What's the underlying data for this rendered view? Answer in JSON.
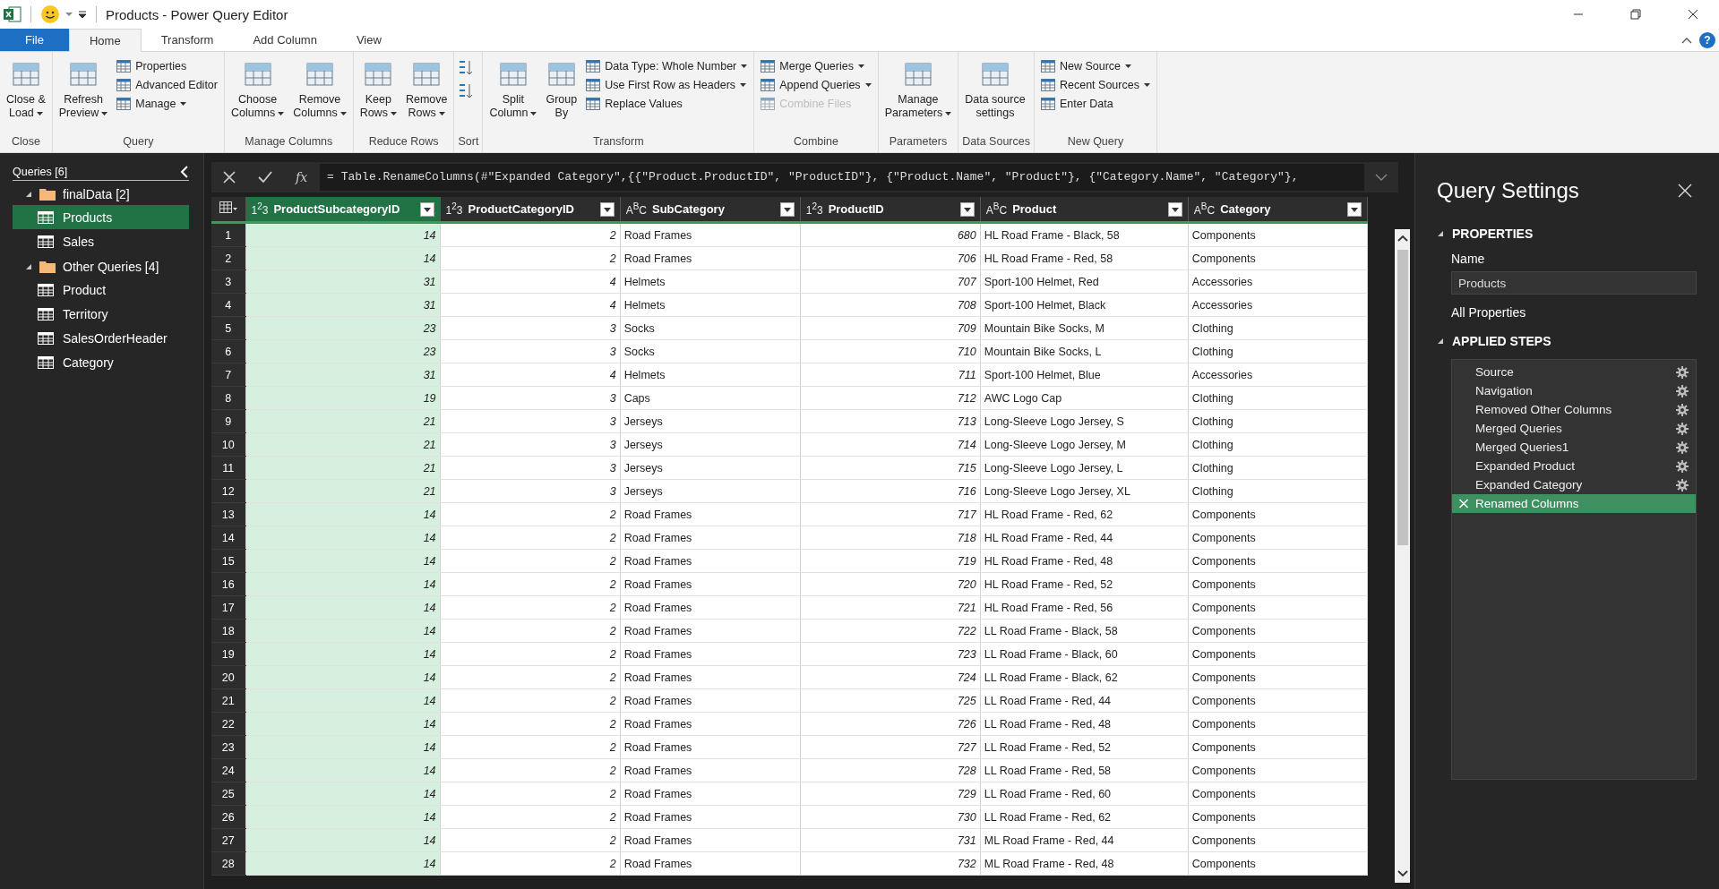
{
  "window": {
    "title": "Products - Power Query Editor",
    "help": "?"
  },
  "tabs": [
    {
      "label": "File",
      "kind": "file",
      "selected": false
    },
    {
      "label": "Home",
      "kind": "tab",
      "selected": true
    },
    {
      "label": "Transform",
      "kind": "tab",
      "selected": false
    },
    {
      "label": "Add Column",
      "kind": "tab",
      "selected": false
    },
    {
      "label": "View",
      "kind": "tab",
      "selected": false
    }
  ],
  "ribbon": {
    "groups": [
      {
        "label": "Close",
        "items": [
          {
            "kind": "large",
            "lines": [
              "Close &",
              "Load"
            ],
            "dropdown": true,
            "disabled": false
          }
        ]
      },
      {
        "label": "Query",
        "items": [
          {
            "kind": "large",
            "lines": [
              "Refresh",
              "Preview"
            ],
            "dropdown": true,
            "disabled": false
          },
          {
            "kind": "small",
            "lines": [
              "Properties"
            ],
            "dropdown": false,
            "disabled": false
          },
          {
            "kind": "small",
            "lines": [
              "Advanced Editor"
            ],
            "dropdown": false,
            "disabled": false
          },
          {
            "kind": "small",
            "lines": [
              "Manage"
            ],
            "dropdown": true,
            "disabled": false
          }
        ]
      },
      {
        "label": "Manage Columns",
        "items": [
          {
            "kind": "large",
            "lines": [
              "Choose",
              "Columns"
            ],
            "dropdown": true,
            "disabled": false
          },
          {
            "kind": "large",
            "lines": [
              "Remove",
              "Columns"
            ],
            "dropdown": true,
            "disabled": false
          }
        ]
      },
      {
        "label": "Reduce Rows",
        "items": [
          {
            "kind": "large",
            "lines": [
              "Keep",
              "Rows"
            ],
            "dropdown": true,
            "disabled": false
          },
          {
            "kind": "large",
            "lines": [
              "Remove",
              "Rows"
            ],
            "dropdown": true,
            "disabled": false
          }
        ]
      },
      {
        "label": "Sort",
        "items": [
          {
            "kind": "sort"
          }
        ]
      },
      {
        "label": "Transform",
        "items": [
          {
            "kind": "large",
            "lines": [
              "Split",
              "Column"
            ],
            "dropdown": true,
            "disabled": false
          },
          {
            "kind": "large",
            "lines": [
              "Group",
              "By"
            ],
            "dropdown": false,
            "disabled": false
          },
          {
            "kind": "small",
            "lines": [
              "Data Type: Whole Number"
            ],
            "dropdown": true,
            "disabled": false
          },
          {
            "kind": "small",
            "lines": [
              "Use First Row as Headers"
            ],
            "dropdown": true,
            "disabled": false
          },
          {
            "kind": "small",
            "lines": [
              "Replace Values"
            ],
            "dropdown": false,
            "disabled": false
          }
        ]
      },
      {
        "label": "Combine",
        "items": [
          {
            "kind": "small",
            "lines": [
              "Merge Queries"
            ],
            "dropdown": true,
            "disabled": false
          },
          {
            "kind": "small",
            "lines": [
              "Append Queries"
            ],
            "dropdown": true,
            "disabled": false
          },
          {
            "kind": "small",
            "lines": [
              "Combine Files"
            ],
            "dropdown": false,
            "disabled": true
          }
        ]
      },
      {
        "label": "Parameters",
        "items": [
          {
            "kind": "large",
            "lines": [
              "Manage",
              "Parameters"
            ],
            "dropdown": true,
            "disabled": false
          }
        ]
      },
      {
        "label": "Data Sources",
        "items": [
          {
            "kind": "large",
            "lines": [
              "Data source",
              "settings"
            ],
            "dropdown": false,
            "disabled": false
          }
        ]
      },
      {
        "label": "New Query",
        "items": [
          {
            "kind": "small",
            "lines": [
              "New Source"
            ],
            "dropdown": true,
            "disabled": false
          },
          {
            "kind": "small",
            "lines": [
              "Recent Sources"
            ],
            "dropdown": true,
            "disabled": false
          },
          {
            "kind": "small",
            "lines": [
              "Enter Data"
            ],
            "dropdown": false,
            "disabled": false
          }
        ]
      }
    ]
  },
  "queries": {
    "title": "Queries [6]",
    "folders": [
      {
        "label": "finalData [2]",
        "expanded": true,
        "children": [
          {
            "label": "Products",
            "selected": true
          },
          {
            "label": "Sales",
            "selected": false
          }
        ]
      },
      {
        "label": "Other Queries [4]",
        "expanded": true,
        "children": [
          {
            "label": "Product",
            "selected": false
          },
          {
            "label": "Territory",
            "selected": false
          },
          {
            "label": "SalesOrderHeader",
            "selected": false
          },
          {
            "label": "Category",
            "selected": false
          }
        ]
      }
    ]
  },
  "formula_bar": {
    "fx": "fx",
    "formula": "= Table.RenameColumns(#\"Expanded Category\",{{\"Product.ProductID\", \"ProductID\"}, {\"Product.Name\", \"Product\"}, {\"Category.Name\", \"Category\"},"
  },
  "table": {
    "columns": [
      {
        "name": "ProductSubcategoryID",
        "type_label": "1$^{2}$3",
        "kind": "number",
        "selected": true
      },
      {
        "name": "ProductCategoryID",
        "type_label": "1$^{2}$3",
        "kind": "number",
        "selected": false
      },
      {
        "name": "SubCategory",
        "type_label": "A$^{B}$C",
        "kind": "text",
        "selected": false
      },
      {
        "name": "ProductID",
        "type_label": "1$^{2}$3",
        "kind": "number",
        "selected": false
      },
      {
        "name": "Product",
        "type_label": "A$^{B}$C",
        "kind": "text",
        "selected": false
      },
      {
        "name": "Category",
        "type_label": "A$^{B}$C",
        "kind": "text",
        "selected": false
      }
    ],
    "rows": [
      {
        "n": "1",
        "cells": [
          "14",
          "2",
          "Road Frames",
          "680",
          "HL Road Frame - Black, 58",
          "Components"
        ]
      },
      {
        "n": "2",
        "cells": [
          "14",
          "2",
          "Road Frames",
          "706",
          "HL Road Frame - Red, 58",
          "Components"
        ]
      },
      {
        "n": "3",
        "cells": [
          "31",
          "4",
          "Helmets",
          "707",
          "Sport-100 Helmet, Red",
          "Accessories"
        ]
      },
      {
        "n": "4",
        "cells": [
          "31",
          "4",
          "Helmets",
          "708",
          "Sport-100 Helmet, Black",
          "Accessories"
        ]
      },
      {
        "n": "5",
        "cells": [
          "23",
          "3",
          "Socks",
          "709",
          "Mountain Bike Socks, M",
          "Clothing"
        ]
      },
      {
        "n": "6",
        "cells": [
          "23",
          "3",
          "Socks",
          "710",
          "Mountain Bike Socks, L",
          "Clothing"
        ]
      },
      {
        "n": "7",
        "cells": [
          "31",
          "4",
          "Helmets",
          "711",
          "Sport-100 Helmet, Blue",
          "Accessories"
        ]
      },
      {
        "n": "8",
        "cells": [
          "19",
          "3",
          "Caps",
          "712",
          "AWC Logo Cap",
          "Clothing"
        ]
      },
      {
        "n": "9",
        "cells": [
          "21",
          "3",
          "Jerseys",
          "713",
          "Long-Sleeve Logo Jersey, S",
          "Clothing"
        ]
      },
      {
        "n": "10",
        "cells": [
          "21",
          "3",
          "Jerseys",
          "714",
          "Long-Sleeve Logo Jersey, M",
          "Clothing"
        ]
      },
      {
        "n": "11",
        "cells": [
          "21",
          "3",
          "Jerseys",
          "715",
          "Long-Sleeve Logo Jersey, L",
          "Clothing"
        ]
      },
      {
        "n": "12",
        "cells": [
          "21",
          "3",
          "Jerseys",
          "716",
          "Long-Sleeve Logo Jersey, XL",
          "Clothing"
        ]
      },
      {
        "n": "13",
        "cells": [
          "14",
          "2",
          "Road Frames",
          "717",
          "HL Road Frame - Red, 62",
          "Components"
        ]
      },
      {
        "n": "14",
        "cells": [
          "14",
          "2",
          "Road Frames",
          "718",
          "HL Road Frame - Red, 44",
          "Components"
        ]
      },
      {
        "n": "15",
        "cells": [
          "14",
          "2",
          "Road Frames",
          "719",
          "HL Road Frame - Red, 48",
          "Components"
        ]
      },
      {
        "n": "16",
        "cells": [
          "14",
          "2",
          "Road Frames",
          "720",
          "HL Road Frame - Red, 52",
          "Components"
        ]
      },
      {
        "n": "17",
        "cells": [
          "14",
          "2",
          "Road Frames",
          "721",
          "HL Road Frame - Red, 56",
          "Components"
        ]
      },
      {
        "n": "18",
        "cells": [
          "14",
          "2",
          "Road Frames",
          "722",
          "LL Road Frame - Black, 58",
          "Components"
        ]
      },
      {
        "n": "19",
        "cells": [
          "14",
          "2",
          "Road Frames",
          "723",
          "LL Road Frame - Black, 60",
          "Components"
        ]
      },
      {
        "n": "20",
        "cells": [
          "14",
          "2",
          "Road Frames",
          "724",
          "LL Road Frame - Black, 62",
          "Components"
        ]
      },
      {
        "n": "21",
        "cells": [
          "14",
          "2",
          "Road Frames",
          "725",
          "LL Road Frame - Red, 44",
          "Components"
        ]
      },
      {
        "n": "22",
        "cells": [
          "14",
          "2",
          "Road Frames",
          "726",
          "LL Road Frame - Red, 48",
          "Components"
        ]
      },
      {
        "n": "23",
        "cells": [
          "14",
          "2",
          "Road Frames",
          "727",
          "LL Road Frame - Red, 52",
          "Components"
        ]
      },
      {
        "n": "24",
        "cells": [
          "14",
          "2",
          "Road Frames",
          "728",
          "LL Road Frame - Red, 58",
          "Components"
        ]
      },
      {
        "n": "25",
        "cells": [
          "14",
          "2",
          "Road Frames",
          "729",
          "LL Road Frame - Red, 60",
          "Components"
        ]
      },
      {
        "n": "26",
        "cells": [
          "14",
          "2",
          "Road Frames",
          "730",
          "LL Road Frame - Red, 62",
          "Components"
        ]
      },
      {
        "n": "27",
        "cells": [
          "14",
          "2",
          "Road Frames",
          "731",
          "ML Road Frame - Red, 44",
          "Components"
        ]
      },
      {
        "n": "28",
        "cells": [
          "14",
          "2",
          "Road Frames",
          "732",
          "ML Road Frame - Red, 48",
          "Components"
        ]
      }
    ]
  },
  "query_settings": {
    "title": "Query Settings",
    "properties_heading": "PROPERTIES",
    "properties_expanded": true,
    "name_label": "Name",
    "name_value": "Products",
    "all_properties": "All Properties",
    "steps_heading": "APPLIED STEPS",
    "steps_expanded": true,
    "steps": [
      {
        "label": "Source",
        "selected": false
      },
      {
        "label": "Navigation",
        "selected": false
      },
      {
        "label": "Removed Other Columns",
        "selected": false
      },
      {
        "label": "Merged Queries",
        "selected": false
      },
      {
        "label": "Merged Queries1",
        "selected": false
      },
      {
        "label": "Expanded Product",
        "selected": false
      },
      {
        "label": "Expanded Category",
        "selected": false
      },
      {
        "label": "Renamed Columns",
        "selected": true
      }
    ]
  }
}
